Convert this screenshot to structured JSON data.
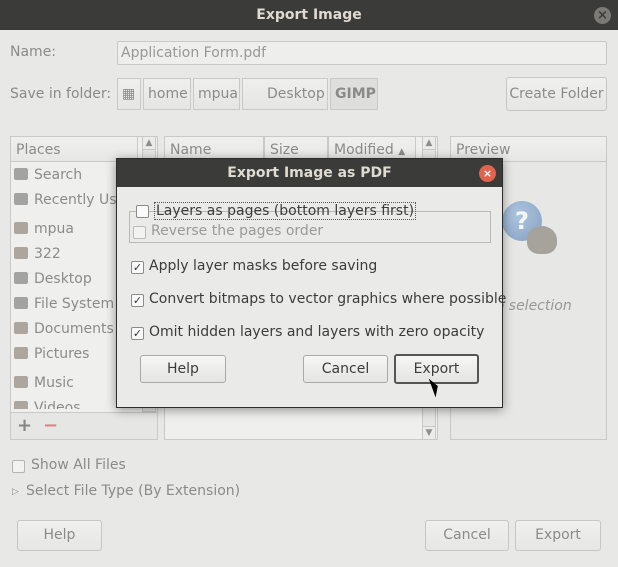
{
  "window": {
    "title": "Export Image",
    "close_glyph": "×"
  },
  "name": {
    "label": "Name:",
    "value": "Application Form.pdf"
  },
  "folder": {
    "label": "Save in folder:",
    "crumbs": [
      "home",
      "mpua",
      "Desktop",
      "GIMP"
    ],
    "create_folder": "Create Folder"
  },
  "places": {
    "header": "Places",
    "items": [
      "Search",
      "Recently Used",
      "mpua",
      "322",
      "Desktop",
      "File System",
      "Documents",
      "Pictures",
      "Music",
      "Videos"
    ],
    "add_glyph": "+",
    "remove_glyph": "−"
  },
  "files": {
    "col_name": "Name",
    "col_size": "Size",
    "col_modified": "Modified",
    "sort_glyph": "▲"
  },
  "preview": {
    "header": "Preview",
    "text": "No selection",
    "icon_glyph": "?"
  },
  "show_all": {
    "label": "Show All Files",
    "checked": false
  },
  "file_type": {
    "label": "Select File Type (By Extension)",
    "expander": "▷"
  },
  "buttons": {
    "help": "Help",
    "cancel": "Cancel",
    "export": "Export"
  },
  "dialog": {
    "title": "Export Image as PDF",
    "close_glyph": "×",
    "opt_layers_pages": "Layers as pages (bottom layers first)",
    "opt_reverse": "Reverse the pages order",
    "opt_masks": "Apply layer masks before saving",
    "opt_vector": "Convert bitmaps to vector graphics where possible",
    "opt_hidden": "Omit hidden layers and layers with zero opacity",
    "check_glyph": "✓",
    "help": "Help",
    "cancel": "Cancel",
    "export": "Export"
  },
  "colors": {
    "titlebar": "#3b3b39",
    "dialog_close": "#e0634f",
    "background": "#e8e8e7"
  }
}
